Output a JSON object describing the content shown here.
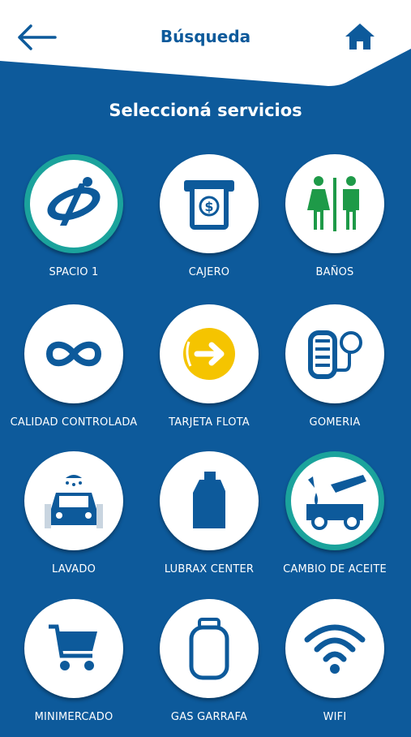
{
  "header": {
    "title": "Búsqueda"
  },
  "section_title": "Seleccioná servicios",
  "services": [
    {
      "label": "SPACIO 1"
    },
    {
      "label": "CAJERO"
    },
    {
      "label": "BAÑOS"
    },
    {
      "label": "CALIDAD CONTROLADA"
    },
    {
      "label": "TARJETA FLOTA"
    },
    {
      "label": "GOMERIA"
    },
    {
      "label": "LAVADO"
    },
    {
      "label": "LUBRAX CENTER"
    },
    {
      "label": "CAMBIO DE ACEITE"
    },
    {
      "label": "MINIMERCADO"
    },
    {
      "label": "GAS GARRAFA"
    },
    {
      "label": "WIFI"
    }
  ],
  "colors": {
    "primary_blue": "#0d5a9b",
    "teal_ring": "#1ba39c",
    "green": "#1e9a48",
    "yellow": "#f5c400"
  }
}
